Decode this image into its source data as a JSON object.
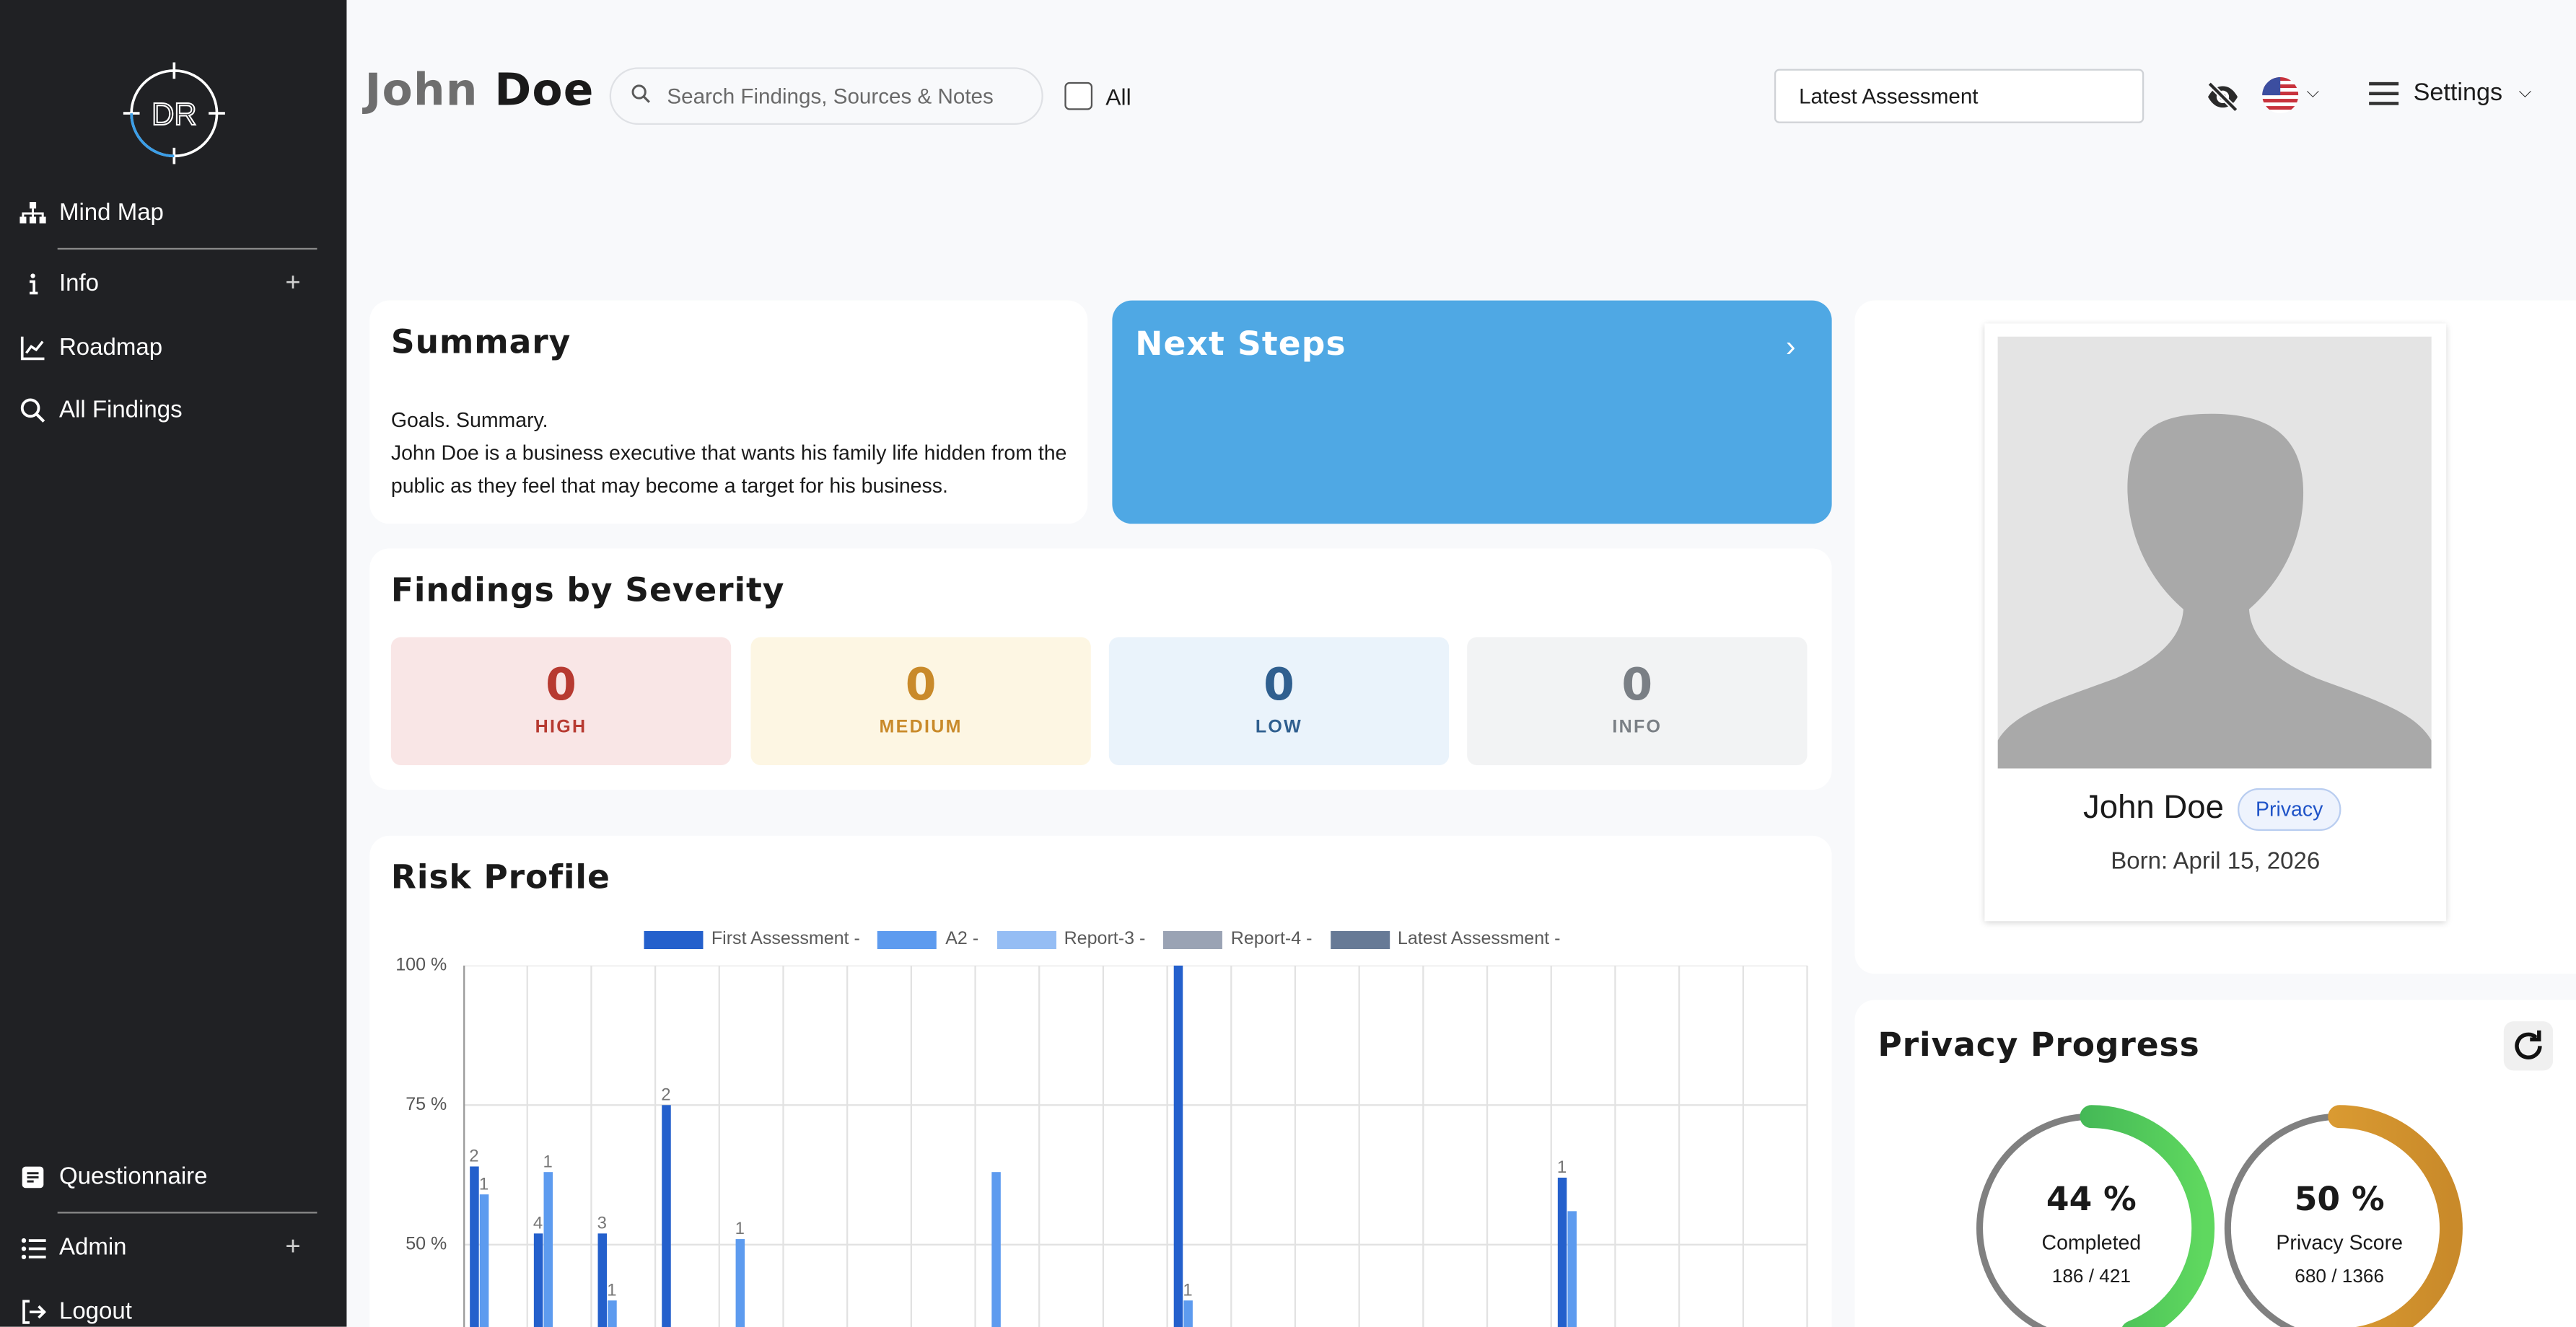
{
  "sidebar": {
    "logo_text": "DR",
    "items": [
      {
        "label": "Mind Map",
        "icon": "sitemap-icon"
      },
      {
        "label": "Info",
        "icon": "info-icon"
      },
      {
        "label": "Roadmap",
        "icon": "chart-line-icon"
      },
      {
        "label": "All Findings",
        "icon": "search-icon"
      },
      {
        "label": "Questionnaire",
        "icon": "clipboard-icon"
      },
      {
        "label": "Admin",
        "icon": "list-icon"
      },
      {
        "label": "Logout",
        "icon": "logout-icon"
      }
    ],
    "expand_symbol": "+"
  },
  "header": {
    "first_name": "John",
    "last_name": "Doe",
    "search_placeholder": "Search Findings, Sources & Notes",
    "all_label": "All",
    "assessment_selected": "Latest Assessment",
    "settings_label": "Settings"
  },
  "summary": {
    "title": "Summary",
    "line1": "Goals. Summary.",
    "line2": "John Doe is a business executive that wants his family life hidden from the public as they feel that may become a target for his business."
  },
  "next_steps": {
    "title": "Next Steps"
  },
  "severity": {
    "title": "Findings by Severity",
    "items": [
      {
        "count": "0",
        "label": "HIGH",
        "bg": "#f9e6e6",
        "color": "#b73a31"
      },
      {
        "count": "0",
        "label": "MEDIUM",
        "bg": "#fdf6e3",
        "color": "#c98a2a"
      },
      {
        "count": "0",
        "label": "LOW",
        "bg": "#eaf3fb",
        "color": "#2f5f8f"
      },
      {
        "count": "0",
        "label": "INFO",
        "bg": "#f2f3f4",
        "color": "#7a7f85"
      }
    ]
  },
  "risk_profile": {
    "title": "Risk Profile"
  },
  "chart_data": {
    "type": "bar",
    "title": "Risk Profile",
    "ylim": [
      0,
      100
    ],
    "ytick_labels": [
      "100 %",
      "75 %",
      "50 %"
    ],
    "grid": true,
    "legend_position": "top",
    "series": [
      {
        "name": "First Assessment -",
        "color": "#2460cc"
      },
      {
        "name": "A2 -",
        "color": "#5d9bef"
      },
      {
        "name": "Report-3 -",
        "color": "#95bdf4"
      },
      {
        "name": "Report-4 -",
        "color": "#9aa3b4"
      },
      {
        "name": "Latest Assessment -",
        "color": "#677a96"
      }
    ],
    "bars": [
      {
        "category": 0,
        "series": 0,
        "value": 64,
        "label": "2"
      },
      {
        "category": 0,
        "series": 1,
        "value": 59,
        "label": "1"
      },
      {
        "category": 1,
        "series": 0,
        "value": 52,
        "label": "4"
      },
      {
        "category": 1,
        "series": 1,
        "value": 63,
        "label": "1"
      },
      {
        "category": 2,
        "series": 0,
        "value": 52,
        "label": "3"
      },
      {
        "category": 2,
        "series": 1,
        "value": 40,
        "label": "1"
      },
      {
        "category": 3,
        "series": 0,
        "value": 75,
        "label": "2"
      },
      {
        "category": 4,
        "series": 1,
        "value": 51,
        "label": "1"
      },
      {
        "category": 8,
        "series": 1,
        "value": 63,
        "label": ""
      },
      {
        "category": 11,
        "series": 0,
        "value": 100,
        "label": "1"
      },
      {
        "category": 11,
        "series": 1,
        "value": 40,
        "label": "1"
      },
      {
        "category": 17,
        "series": 0,
        "value": 62,
        "label": "1"
      },
      {
        "category": 17,
        "series": 1,
        "value": 56,
        "label": ""
      }
    ],
    "category_count": 21
  },
  "profile": {
    "name": "John Doe",
    "badge": "Privacy",
    "born": "Born: April 15, 2026"
  },
  "privacy_progress": {
    "title": "Privacy Progress",
    "gauges": [
      {
        "percent": "44 %",
        "label": "Completed",
        "ratio": "186 / 421",
        "value": 0.44,
        "color_start": "#2e9e4f",
        "color_end": "#5fd85f"
      },
      {
        "percent": "50 %",
        "label": "Privacy Score",
        "ratio": "680 / 1366",
        "value": 0.5,
        "color_start": "#e8a838",
        "color_end": "#c98a2a"
      }
    ]
  }
}
